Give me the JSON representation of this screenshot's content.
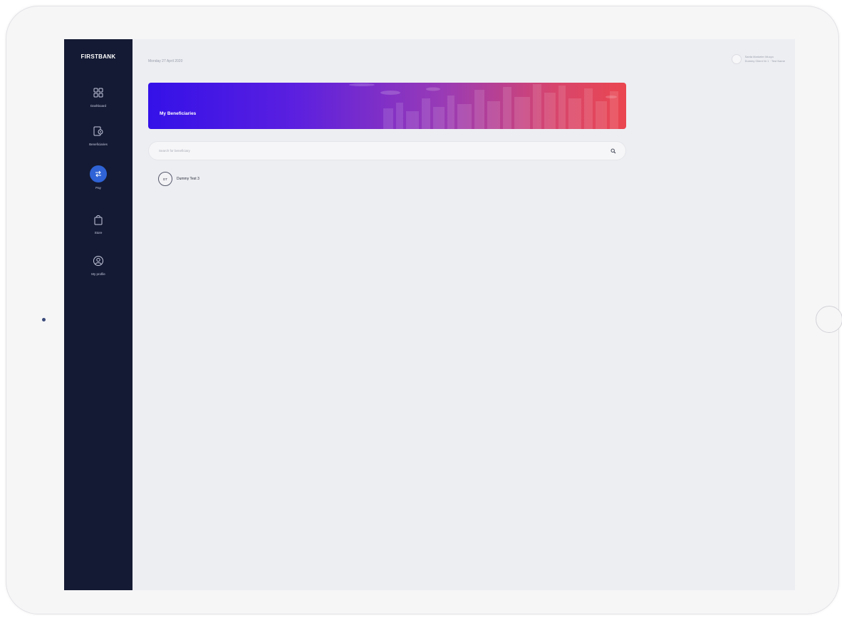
{
  "sidebar": {
    "logo": "FIRSTBANK",
    "items": [
      {
        "label": "Dashboard",
        "icon": "dashboard-grid-icon",
        "active": false
      },
      {
        "label": "Beneficiaries",
        "icon": "beneficiaries-card-icon",
        "active": false
      },
      {
        "label": "Pay",
        "icon": "transfer-arrows-icon",
        "active": true
      },
      {
        "label": "Store",
        "icon": "shopping-bag-icon",
        "active": false
      },
      {
        "label": "My profile",
        "icon": "profile-user-icon",
        "active": false
      }
    ]
  },
  "header": {
    "date": "Monday 27 April 2020",
    "user_name": "Santa Marketer Mucyo",
    "user_account": "Dummy Client Nr 1 · Test Name"
  },
  "banner": {
    "title": "My Beneficiaries"
  },
  "search": {
    "placeholder": "Search for beneficiary"
  },
  "beneficiaries": [
    {
      "initials": "DT",
      "name": "Dummy Test 3"
    }
  ],
  "colors": {
    "sidebar_bg": "#141a33",
    "screen_bg": "#edeef2",
    "active_accent": "#2f63d6",
    "banner_start": "#3411e8",
    "banner_end": "#ea4650"
  }
}
